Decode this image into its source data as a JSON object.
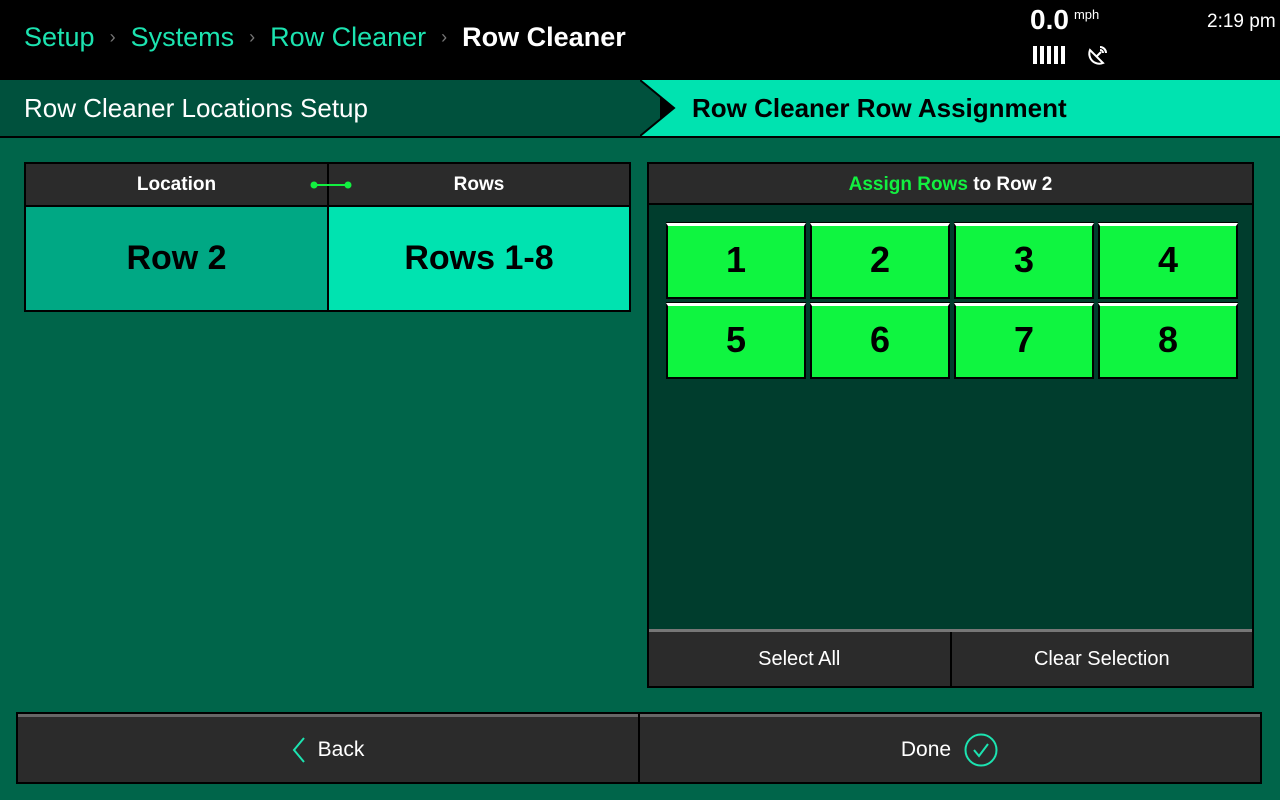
{
  "breadcrumb": {
    "items": [
      "Setup",
      "Systems",
      "Row Cleaner"
    ],
    "current": "Row Cleaner",
    "separator": "›"
  },
  "status": {
    "speed_value": "0.0",
    "speed_unit": "mph",
    "signal_bars": 5,
    "gps_icon": "satellite-dish-icon",
    "time": "2:19 pm"
  },
  "tabs": {
    "left": "Row Cleaner Locations Setup",
    "right": "Row Cleaner Row Assignment"
  },
  "location_table": {
    "headers": [
      "Location",
      "Rows"
    ],
    "link_icon": "link-icon",
    "rows": [
      {
        "location": "Row 2",
        "rows": "Rows 1-8"
      }
    ]
  },
  "assign_panel": {
    "title_highlight": "Assign Rows",
    "title_rest": " to Row 2",
    "row_buttons": [
      "1",
      "2",
      "3",
      "4",
      "5",
      "6",
      "7",
      "8"
    ],
    "selected_rows": [
      "1",
      "2",
      "3",
      "4",
      "5",
      "6",
      "7",
      "8"
    ],
    "select_all": "Select All",
    "clear_selection": "Clear Selection"
  },
  "footer": {
    "back": "Back",
    "back_icon": "chevron-left-icon",
    "done": "Done",
    "done_icon": "check-circle-icon"
  },
  "colors": {
    "accent": "#1ce3b0",
    "selected_row": "#0ff540",
    "location_cell": "#00a884",
    "rows_cell": "#00e3b0",
    "background": "#00654a"
  }
}
